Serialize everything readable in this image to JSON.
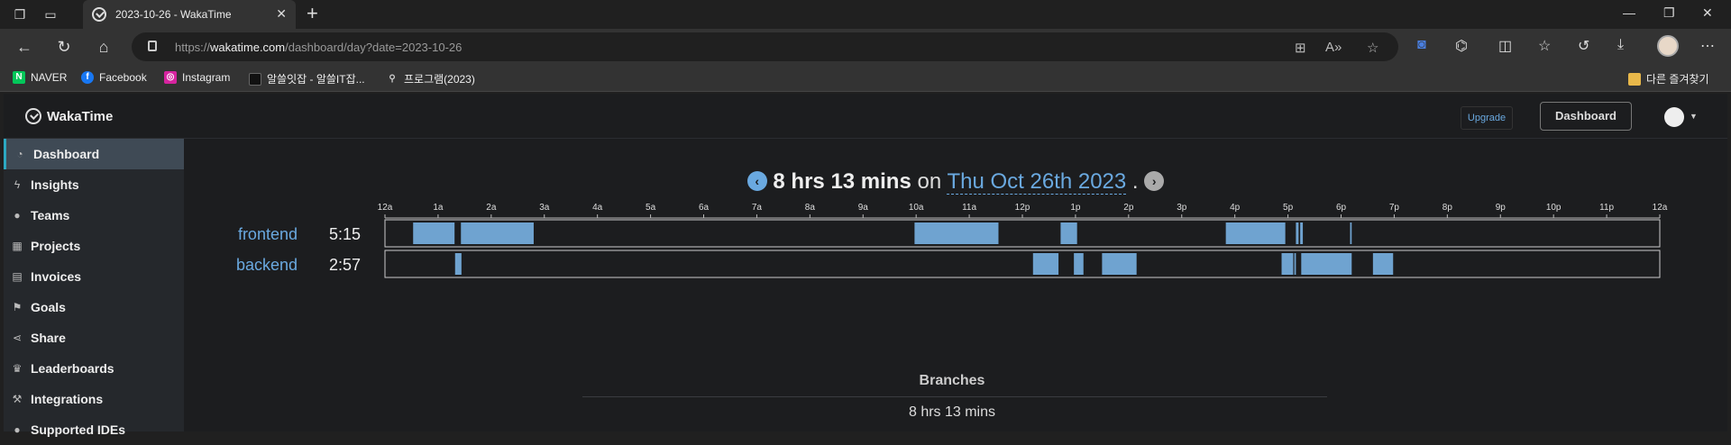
{
  "browser": {
    "tab_title": "2023-10-26 - WakaTime",
    "url_prefix": "https://",
    "url_host": "wakatime.com",
    "url_path": "/dashboard/day?date=2023-10-26",
    "bookmarks": [
      {
        "label": "NAVER",
        "icon": "naver-icon",
        "color": "#03c75a",
        "glyph": "N"
      },
      {
        "label": "Facebook",
        "icon": "facebook-icon",
        "color": "#1877f2",
        "glyph": "f"
      },
      {
        "label": "Instagram",
        "icon": "instagram-icon",
        "color": "#d6249f",
        "glyph": "◎"
      },
      {
        "label": "알쓸잇잡 - 알쓸IT잡...",
        "icon": "site-icon",
        "color": "#222",
        "glyph": "■"
      },
      {
        "label": "프로그램(2023)",
        "icon": "search-icon",
        "color": "#333",
        "glyph": "🔍"
      }
    ],
    "other_bookmarks": "다른 즐겨찾기"
  },
  "app": {
    "logo": "WakaTime",
    "upgrade": "Upgrade",
    "dashboard": "Dashboard"
  },
  "sidebar": {
    "items": [
      {
        "label": "Dashboard",
        "icon": "dashboard-icon",
        "glyph": "◔",
        "active": true
      },
      {
        "label": "Insights",
        "icon": "bolt-icon",
        "glyph": "⚡"
      },
      {
        "label": "Teams",
        "icon": "users-icon",
        "glyph": "👥"
      },
      {
        "label": "Projects",
        "icon": "grid-icon",
        "glyph": "▦"
      },
      {
        "label": "Invoices",
        "icon": "file-icon",
        "glyph": "▤"
      },
      {
        "label": "Goals",
        "icon": "flag-icon",
        "glyph": "⚑"
      },
      {
        "label": "Share",
        "icon": "share-icon",
        "glyph": "⋖"
      },
      {
        "label": "Leaderboards",
        "icon": "trophy-icon",
        "glyph": "🏆"
      },
      {
        "label": "Integrations",
        "icon": "wrench-icon",
        "glyph": "🔧"
      },
      {
        "label": "Supported IDEs",
        "icon": "plug-icon",
        "glyph": "●"
      }
    ]
  },
  "summary": {
    "total": "8 hrs 13 mins",
    "on": "on",
    "date": "Thu Oct 26th 2023",
    "period": "."
  },
  "chart_data": {
    "type": "timeline",
    "ticks": [
      "12a",
      "1a",
      "2a",
      "3a",
      "4a",
      "5a",
      "6a",
      "7a",
      "8a",
      "9a",
      "10a",
      "11a",
      "12p",
      "1p",
      "2p",
      "3p",
      "4p",
      "5p",
      "6p",
      "7p",
      "8p",
      "9p",
      "10p",
      "11p",
      "12a"
    ],
    "xlim": [
      0,
      24
    ],
    "series": [
      {
        "name": "frontend",
        "total": "5:15",
        "color": "#6fa3d0",
        "segments": [
          [
            0.53,
            1.31
          ],
          [
            1.43,
            2.8
          ],
          [
            9.97,
            11.55
          ],
          [
            12.72,
            13.03
          ],
          [
            15.83,
            16.95
          ],
          [
            17.15,
            17.2
          ],
          [
            17.23,
            17.28
          ],
          [
            18.17,
            18.2
          ]
        ]
      },
      {
        "name": "backend",
        "total": "2:57",
        "color": "#6fa3d0",
        "segments": [
          [
            1.32,
            1.44
          ],
          [
            12.2,
            12.68
          ],
          [
            12.97,
            13.15
          ],
          [
            13.5,
            14.15
          ],
          [
            16.88,
            17.1
          ],
          [
            17.12,
            17.15
          ],
          [
            17.25,
            18.2
          ],
          [
            18.6,
            18.98
          ]
        ]
      }
    ]
  },
  "branches": {
    "title": "Branches",
    "total": "8 hrs 13 mins"
  }
}
